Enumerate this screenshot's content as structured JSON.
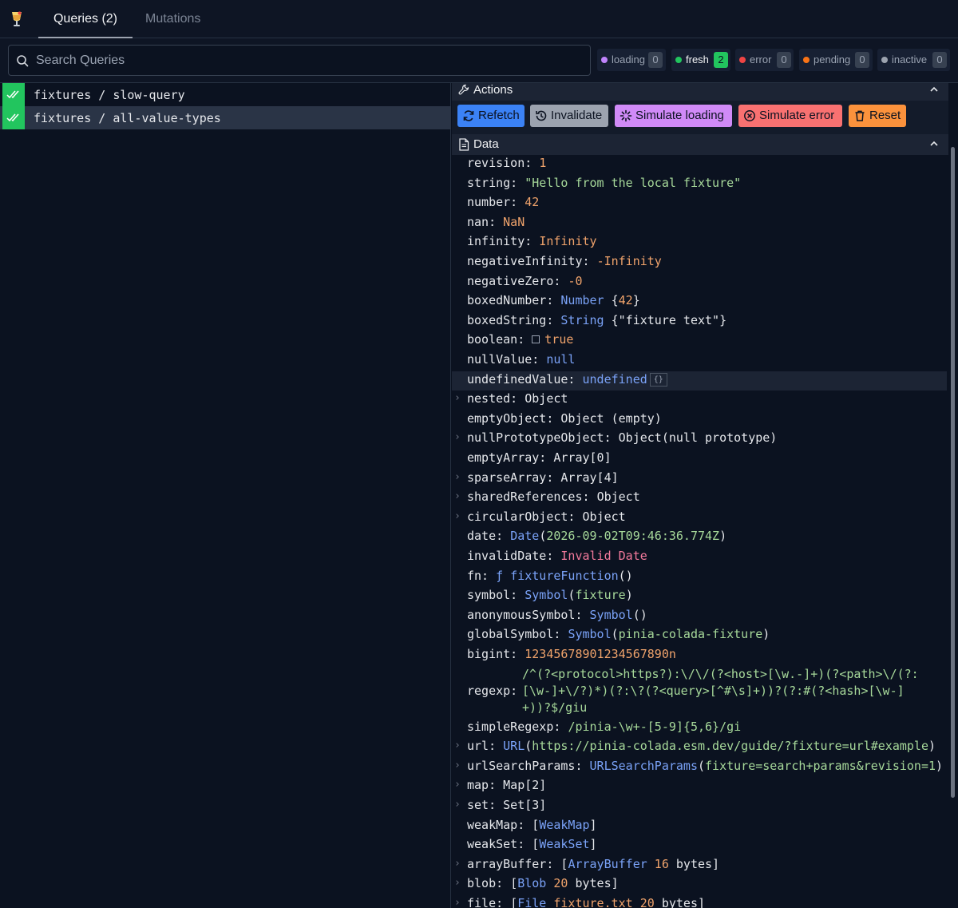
{
  "tabs": {
    "queries": "Queries (2)",
    "mutations": "Mutations"
  },
  "search": {
    "placeholder": "Search Queries",
    "value": ""
  },
  "badges": [
    {
      "label": "loading",
      "count": "0",
      "color": "#c084fc"
    },
    {
      "label": "fresh",
      "count": "2",
      "color": "#22c55e"
    },
    {
      "label": "error",
      "count": "0",
      "color": "#ef4444"
    },
    {
      "label": "pending",
      "count": "0",
      "color": "#f97316"
    },
    {
      "label": "inactive",
      "count": "0",
      "color": "#9ca3af"
    }
  ],
  "queries": [
    {
      "key": "fixtures / slow-query",
      "status": "fresh"
    },
    {
      "key": "fixtures / all-value-types",
      "status": "fresh"
    }
  ],
  "actions": {
    "title": "Actions",
    "refetch": "Refetch",
    "invalidate": "Invalidate",
    "simulate_loading": "Simulate loading",
    "simulate_error": "Simulate error",
    "reset": "Reset"
  },
  "data_section": {
    "title": "Data"
  },
  "data": {
    "revision": {
      "k": "revision: ",
      "v": "1"
    },
    "string": {
      "k": "string: ",
      "v": "\"Hello from the local fixture\""
    },
    "number": {
      "k": "number: ",
      "v": "42"
    },
    "nan": {
      "k": "nan: ",
      "v": "NaN"
    },
    "infinity": {
      "k": "infinity: ",
      "v": "Infinity"
    },
    "negativeInfinity": {
      "k": "negativeInfinity: ",
      "v": "-Infinity"
    },
    "negativeZero": {
      "k": "negativeZero: ",
      "v": "-0"
    },
    "boxedNumber": {
      "k": "boxedNumber: ",
      "t": "Number",
      "o": " {",
      "v": "42",
      "c": "}"
    },
    "boxedString": {
      "k": "boxedString: ",
      "t": "String",
      "o": " {",
      "v": "\"fixture text\"",
      "c": "}"
    },
    "boolean": {
      "k": "boolean: ",
      "v": "true"
    },
    "nullValue": {
      "k": "nullValue: ",
      "v": "null"
    },
    "undefinedValue": {
      "k": "undefinedValue: ",
      "v": "undefined",
      "box": "{}"
    },
    "nested": {
      "k": "nested: ",
      "v": "Object"
    },
    "emptyObject": {
      "k": "emptyObject: ",
      "v": "Object (empty)"
    },
    "nullPrototypeObject": {
      "k": "nullPrototypeObject: ",
      "v": "Object(null prototype)"
    },
    "emptyArray": {
      "k": "emptyArray: ",
      "v": "Array[0]"
    },
    "sparseArray": {
      "k": "sparseArray: ",
      "v": "Array[4]"
    },
    "sharedReferences": {
      "k": "sharedReferences: ",
      "v": "Object"
    },
    "circularObject": {
      "k": "circularObject: ",
      "v": "Object"
    },
    "date": {
      "k": "date: ",
      "t": "Date",
      "o": "(",
      "v": "2026-09-02T09:46:36.774Z",
      "c": ")"
    },
    "invalidDate": {
      "k": "invalidDate: ",
      "v": "Invalid Date"
    },
    "fn": {
      "k": "fn: ",
      "t": "ƒ fixtureFunction",
      "c": "()"
    },
    "symbol": {
      "k": "symbol: ",
      "t": "Symbol",
      "o": "(",
      "v": "fixture",
      "c": ")"
    },
    "anonymousSymbol": {
      "k": "anonymousSymbol: ",
      "t": "Symbol",
      "c": "()"
    },
    "globalSymbol": {
      "k": "globalSymbol: ",
      "t": "Symbol",
      "o": "(",
      "v": "pinia-colada-fixture",
      "c": ")"
    },
    "bigint": {
      "k": "bigint: ",
      "v": "12345678901234567890n"
    },
    "regexp": {
      "k": "regexp: ",
      "v": "/^(?<protocol>https?):\\/\\/(?<host>[\\w.-]+)(?<path>\\/(?:[\\w-]+\\/?)*)(?:\\?(?<query>[^#\\s]+))?(?:#(?<hash>[\\w-]+))?$/giu"
    },
    "simpleRegexp": {
      "k": "simpleRegexp: ",
      "v": "/pinia-\\w+-[5-9]{5,6}/gi"
    },
    "url": {
      "k": "url: ",
      "t": "URL",
      "o": "(",
      "v": "https://pinia-colada.esm.dev/guide/?fixture=url#example",
      "c": ")"
    },
    "urlSearchParams": {
      "k": "urlSearchParams: ",
      "t": "URLSearchParams",
      "o": "(",
      "v": "fixture=search+params&revision=1",
      "c": ")"
    },
    "map": {
      "k": "map: ",
      "v": "Map[2]"
    },
    "set": {
      "k": "set: ",
      "v": "Set[3]"
    },
    "weakMap": {
      "k": "weakMap: ",
      "o": "[",
      "t": "WeakMap",
      "c": "]"
    },
    "weakSet": {
      "k": "weakSet: ",
      "o": "[",
      "t": "WeakSet",
      "c": "]"
    },
    "arrayBuffer": {
      "k": "arrayBuffer: ",
      "o": "[",
      "t": "ArrayBuffer",
      "v": " 16",
      "c": " bytes]"
    },
    "blob": {
      "k": "blob: ",
      "o": "[",
      "t": "Blob",
      "v": " 20",
      "c": " bytes]"
    },
    "file": {
      "k": "file: ",
      "o": "[",
      "t": "File",
      "v": " fixture.txt 20",
      "c": " bytes]"
    }
  }
}
